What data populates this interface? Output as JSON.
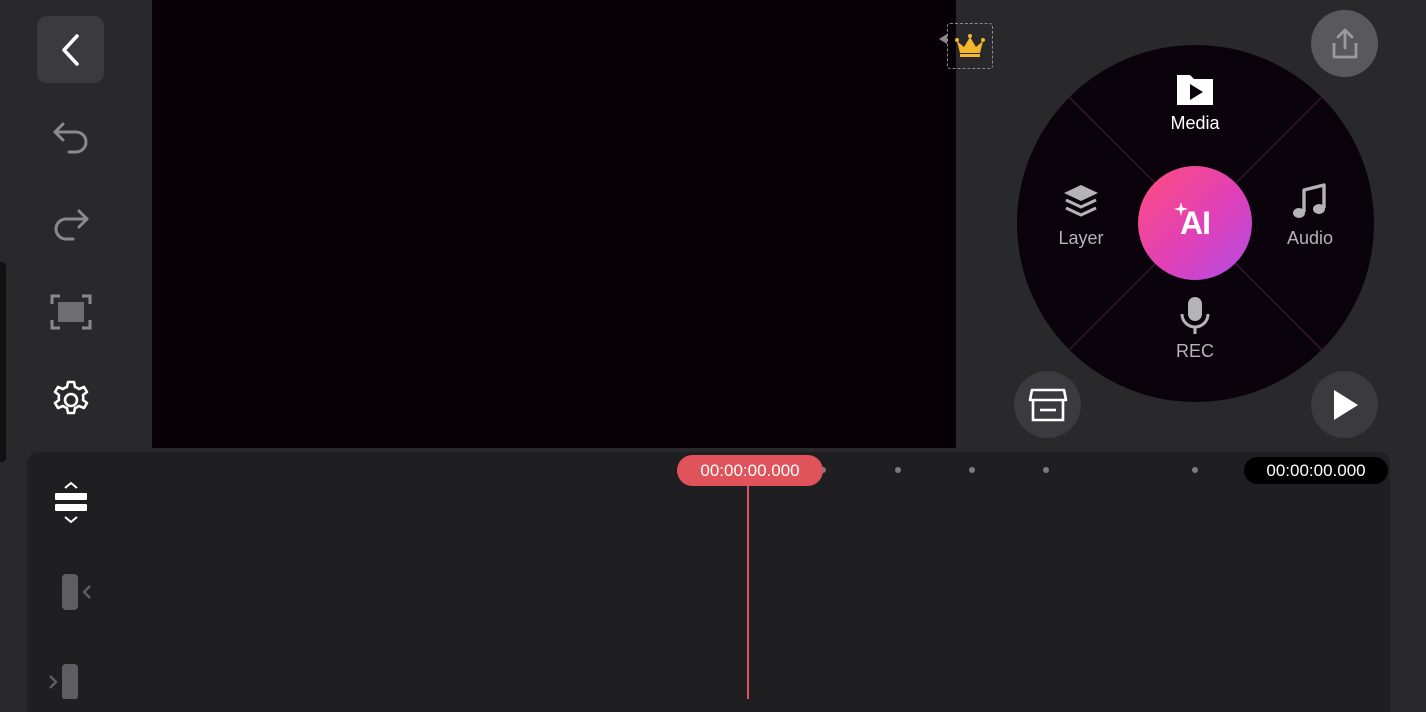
{
  "toolbar": {
    "back": "back-icon",
    "undo": "undo-icon",
    "redo": "redo-icon",
    "fullscreen": "fullscreen-icon",
    "settings": "gear-icon"
  },
  "wheel": {
    "media_label": "Media",
    "layer_label": "Layer",
    "audio_label": "Audio",
    "rec_label": "REC",
    "ai_label": "AI"
  },
  "timeline": {
    "current_time": "00:00:00.000",
    "end_time": "00:00:00.000"
  },
  "colors": {
    "playhead": "#e0535b",
    "ai_gradient_start": "#ff4e7c",
    "ai_gradient_end": "#b04ee6",
    "premium_crown": "#f5b62a"
  }
}
